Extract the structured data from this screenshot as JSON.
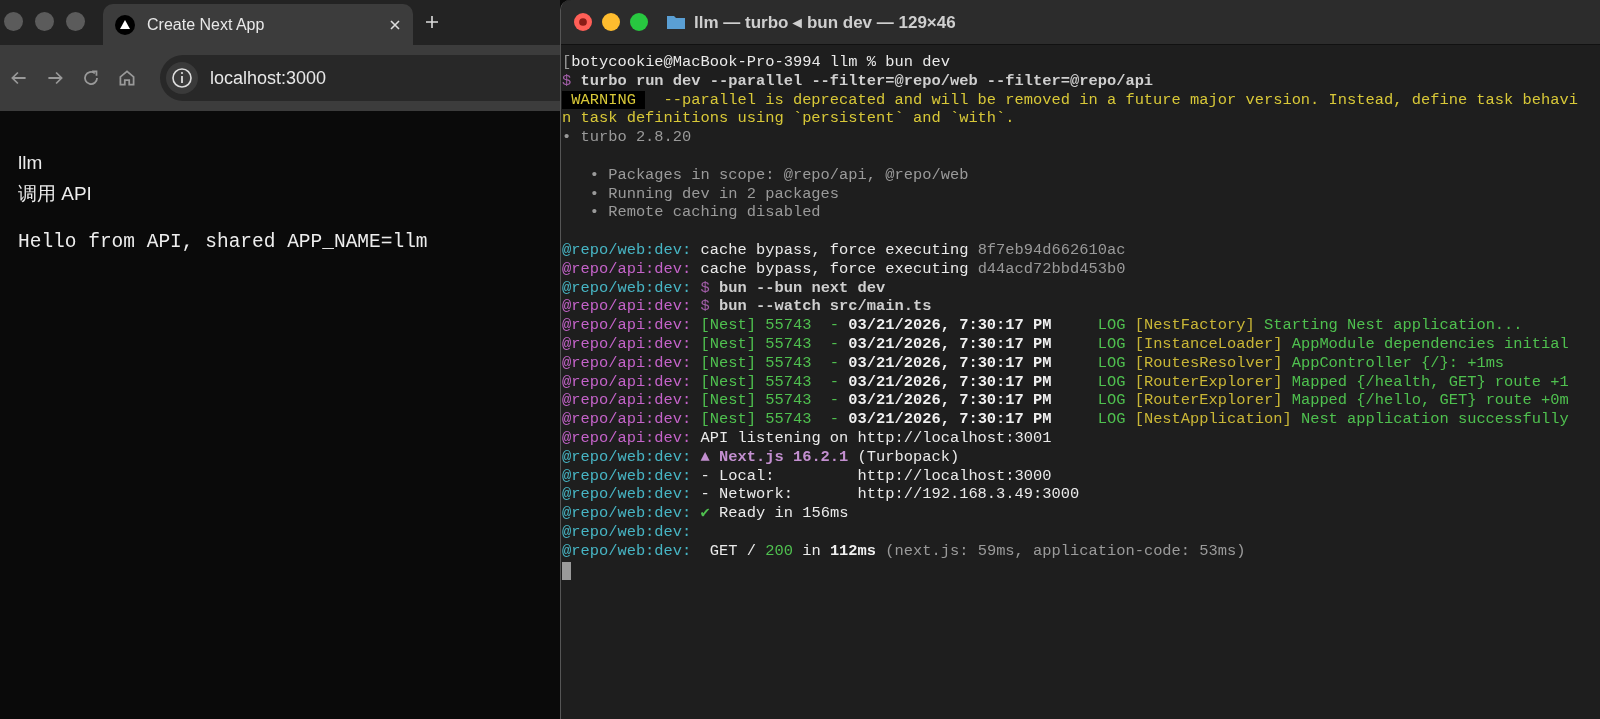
{
  "browser": {
    "tab": {
      "title": "Create Next App",
      "selected": true
    },
    "address": "localhost:3000",
    "content": {
      "headings": [
        "llm",
        "调用 API"
      ],
      "message": "Hello from API, shared APP_NAME=llm"
    }
  },
  "terminal": {
    "title": "llm — turbo ◂ bun dev — 129×46",
    "lines": [
      {
        "kind": "text",
        "segments": [
          {
            "kind": "dim",
            "text": "["
          },
          {
            "kind": "plain",
            "text": "botycookie@MacBook-Pro-3994 llm % bun dev"
          }
        ]
      },
      {
        "kind": "text",
        "segments": [
          {
            "kind": "sym",
            "text": "$ "
          },
          {
            "kind": "command",
            "text": "turbo run dev --parallel --filter=@repo/web --filter=@repo/api"
          }
        ]
      },
      {
        "kind": "text",
        "segments": [
          {
            "kind": "badge",
            "text": " WARNING "
          },
          {
            "kind": "warn",
            "text": "  --parallel is deprecated and will be removed in a future major version. Instead, define task behavi"
          }
        ]
      },
      {
        "kind": "text",
        "segments": [
          {
            "kind": "warn",
            "text": "n task definitions using `persistent` and `with`."
          }
        ]
      },
      {
        "kind": "text",
        "segments": [
          {
            "kind": "dim",
            "text": "• turbo 2.8.20"
          }
        ]
      },
      {
        "kind": "blank"
      },
      {
        "kind": "text",
        "segments": [
          {
            "kind": "dim",
            "text": "   • Packages in scope: @repo/api, @repo/web"
          }
        ]
      },
      {
        "kind": "text",
        "segments": [
          {
            "kind": "dim",
            "text": "   • Running dev in 2 packages"
          }
        ]
      },
      {
        "kind": "text",
        "segments": [
          {
            "kind": "dim",
            "text": "   • Remote caching disabled"
          }
        ]
      },
      {
        "kind": "blank"
      },
      {
        "kind": "text",
        "segments": [
          {
            "kind": "web",
            "text": "@repo/web:dev: "
          },
          {
            "kind": "plain",
            "text": "cache bypass, force executing "
          },
          {
            "kind": "dim",
            "text": "8f7eb94d662610ac"
          }
        ]
      },
      {
        "kind": "text",
        "segments": [
          {
            "kind": "api",
            "text": "@repo/api:dev: "
          },
          {
            "kind": "plain",
            "text": "cache bypass, force executing "
          },
          {
            "kind": "dim",
            "text": "d44acd72bbd453b0"
          }
        ]
      },
      {
        "kind": "text",
        "segments": [
          {
            "kind": "web",
            "text": "@repo/web:dev: "
          },
          {
            "kind": "sym",
            "text": "$ "
          },
          {
            "kind": "command",
            "text": "bun --bun next dev"
          }
        ]
      },
      {
        "kind": "text",
        "segments": [
          {
            "kind": "api",
            "text": "@repo/api:dev: "
          },
          {
            "kind": "sym",
            "text": "$ "
          },
          {
            "kind": "command",
            "text": "bun --watch src/main.ts"
          }
        ]
      },
      {
        "kind": "text",
        "segments": [
          {
            "kind": "api",
            "text": "@repo/api:dev: "
          },
          {
            "kind": "green",
            "text": "[Nest] 55743  - "
          },
          {
            "kind": "bold",
            "text": "03/21/2026, 7:30:17 PM"
          },
          {
            "kind": "green",
            "text": "     LOG "
          },
          {
            "kind": "yellow",
            "text": "[NestFactory] "
          },
          {
            "kind": "green",
            "text": "Starting Nest application..."
          }
        ]
      },
      {
        "kind": "text",
        "segments": [
          {
            "kind": "api",
            "text": "@repo/api:dev: "
          },
          {
            "kind": "green",
            "text": "[Nest] 55743  - "
          },
          {
            "kind": "bold",
            "text": "03/21/2026, 7:30:17 PM"
          },
          {
            "kind": "green",
            "text": "     LOG "
          },
          {
            "kind": "yellow",
            "text": "[InstanceLoader] "
          },
          {
            "kind": "green",
            "text": "AppModule dependencies initial"
          }
        ]
      },
      {
        "kind": "text",
        "segments": [
          {
            "kind": "api",
            "text": "@repo/api:dev: "
          },
          {
            "kind": "green",
            "text": "[Nest] 55743  - "
          },
          {
            "kind": "bold",
            "text": "03/21/2026, 7:30:17 PM"
          },
          {
            "kind": "green",
            "text": "     LOG "
          },
          {
            "kind": "yellow",
            "text": "[RoutesResolver] "
          },
          {
            "kind": "green",
            "text": "AppController {/}: +1ms"
          }
        ]
      },
      {
        "kind": "text",
        "segments": [
          {
            "kind": "api",
            "text": "@repo/api:dev: "
          },
          {
            "kind": "green",
            "text": "[Nest] 55743  - "
          },
          {
            "kind": "bold",
            "text": "03/21/2026, 7:30:17 PM"
          },
          {
            "kind": "green",
            "text": "     LOG "
          },
          {
            "kind": "yellow",
            "text": "[RouterExplorer] "
          },
          {
            "kind": "green",
            "text": "Mapped {/health, GET} route +1"
          }
        ]
      },
      {
        "kind": "text",
        "segments": [
          {
            "kind": "api",
            "text": "@repo/api:dev: "
          },
          {
            "kind": "green",
            "text": "[Nest] 55743  - "
          },
          {
            "kind": "bold",
            "text": "03/21/2026, 7:30:17 PM"
          },
          {
            "kind": "green",
            "text": "     LOG "
          },
          {
            "kind": "yellow",
            "text": "[RouterExplorer] "
          },
          {
            "kind": "green",
            "text": "Mapped {/hello, GET} route +0m"
          }
        ]
      },
      {
        "kind": "text",
        "segments": [
          {
            "kind": "api",
            "text": "@repo/api:dev: "
          },
          {
            "kind": "green",
            "text": "[Nest] 55743  - "
          },
          {
            "kind": "bold",
            "text": "03/21/2026, 7:30:17 PM"
          },
          {
            "kind": "green",
            "text": "     LOG "
          },
          {
            "kind": "yellow",
            "text": "[NestApplication] "
          },
          {
            "kind": "green",
            "text": "Nest application successfully"
          }
        ]
      },
      {
        "kind": "text",
        "segments": [
          {
            "kind": "api",
            "text": "@repo/api:dev: "
          },
          {
            "kind": "plain",
            "text": "API listening on http://localhost:3001"
          }
        ]
      },
      {
        "kind": "text",
        "segments": [
          {
            "kind": "web",
            "text": "@repo/web:dev: "
          },
          {
            "kind": "next",
            "text": "▲ Next.js 16.2.1"
          },
          {
            "kind": "plain",
            "text": " (Turbopack)"
          }
        ]
      },
      {
        "kind": "text",
        "segments": [
          {
            "kind": "web",
            "text": "@repo/web:dev: "
          },
          {
            "kind": "plain",
            "text": "- Local:         http://localhost:3000"
          }
        ]
      },
      {
        "kind": "text",
        "segments": [
          {
            "kind": "web",
            "text": "@repo/web:dev: "
          },
          {
            "kind": "plain",
            "text": "- Network:       http://192.168.3.49:3000"
          }
        ]
      },
      {
        "kind": "text",
        "segments": [
          {
            "kind": "web",
            "text": "@repo/web:dev: "
          },
          {
            "kind": "green",
            "text": "✔"
          },
          {
            "kind": "plain",
            "text": " Ready in 156ms"
          }
        ]
      },
      {
        "kind": "text",
        "segments": [
          {
            "kind": "web",
            "text": "@repo/web:dev:"
          }
        ]
      },
      {
        "kind": "text",
        "segments": [
          {
            "kind": "web",
            "text": "@repo/web:dev: "
          },
          {
            "kind": "plain",
            "text": " GET / "
          },
          {
            "kind": "green",
            "text": "200"
          },
          {
            "kind": "plain",
            "text": " in "
          },
          {
            "kind": "bold",
            "text": "112ms"
          },
          {
            "kind": "dim",
            "text": " (next.js: 59ms, application-code: 53ms)"
          }
        ]
      }
    ]
  }
}
